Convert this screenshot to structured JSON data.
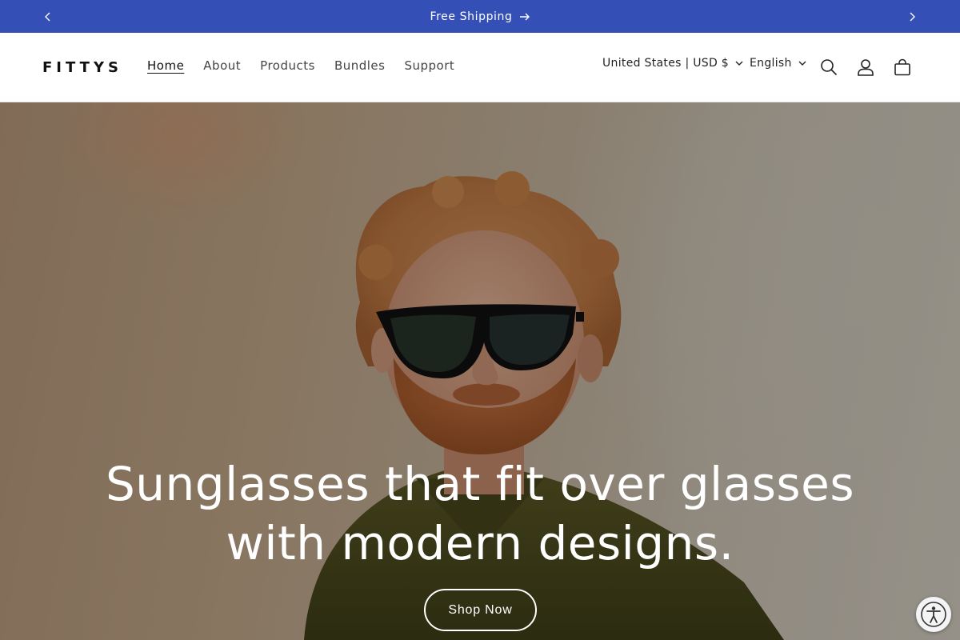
{
  "announcement": {
    "text": "Free Shipping"
  },
  "brand": {
    "name": "FITTYS",
    "accent_color": "#3450b6"
  },
  "nav": {
    "items": [
      {
        "label": "Home",
        "active": true
      },
      {
        "label": "About",
        "active": false
      },
      {
        "label": "Products",
        "active": false
      },
      {
        "label": "Bundles",
        "active": false
      },
      {
        "label": "Support",
        "active": false
      }
    ]
  },
  "header": {
    "country": "United States | USD $",
    "language": "English",
    "icons": [
      "search-icon",
      "account-icon",
      "cart-icon"
    ]
  },
  "hero": {
    "heading": "Sunglasses that fit over glasses with modern designs.",
    "cta_label": "Shop Now"
  },
  "accessibility": {
    "icon": "accessibility-icon"
  }
}
